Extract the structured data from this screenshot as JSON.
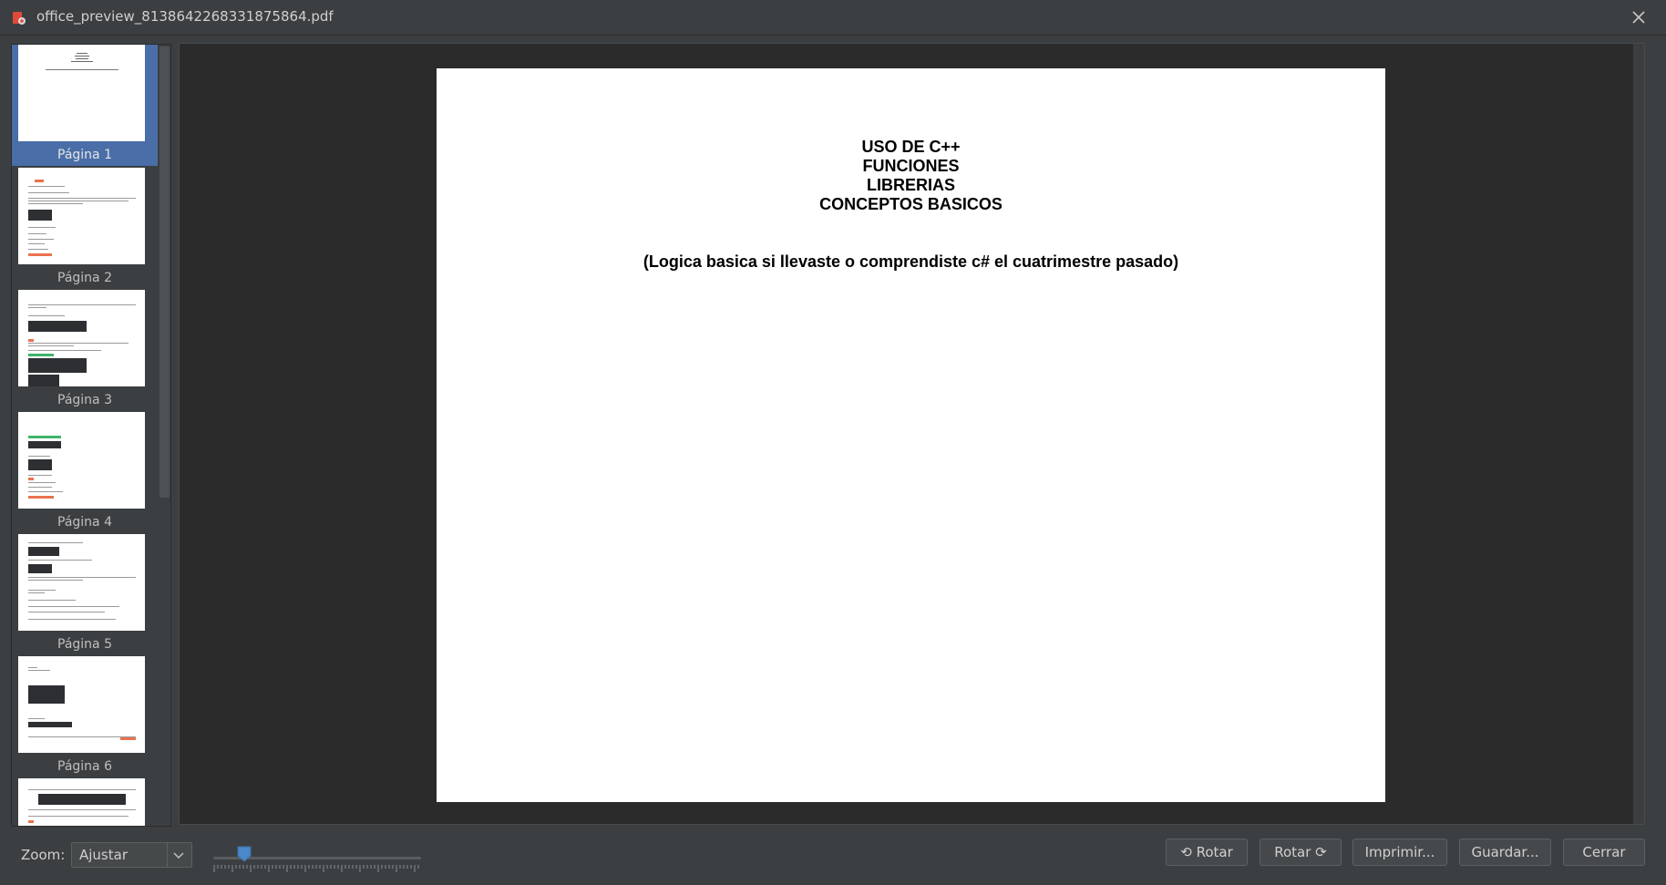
{
  "window": {
    "title": "office_preview_8138642268331875864.pdf"
  },
  "thumbnails": [
    {
      "label": "Página 1",
      "selected": true
    },
    {
      "label": "Página 2",
      "selected": false
    },
    {
      "label": "Página 3",
      "selected": false
    },
    {
      "label": "Página 4",
      "selected": false
    },
    {
      "label": "Página 5",
      "selected": false
    },
    {
      "label": "Página 6",
      "selected": false
    }
  ],
  "document": {
    "title_lines": [
      "USO DE C++",
      "FUNCIONES",
      "LIBRERIAS",
      "CONCEPTOS BASICOS"
    ],
    "subtitle": "(Logica basica si llevaste o comprendiste c# el cuatrimestre pasado)"
  },
  "toolbar": {
    "zoom_label": "Zoom:",
    "zoom_value": "Ajustar",
    "rotate_left_label": "⟲ Rotar",
    "rotate_right_label": "Rotar ⟳",
    "print_label": "Imprimir...",
    "save_label": "Guardar...",
    "close_label": "Cerrar"
  },
  "colors": {
    "selection": "#4a6ea8",
    "slider_knob": "#4a88c7",
    "background": "#3c3f41",
    "viewer_background": "#2b2b2b"
  }
}
